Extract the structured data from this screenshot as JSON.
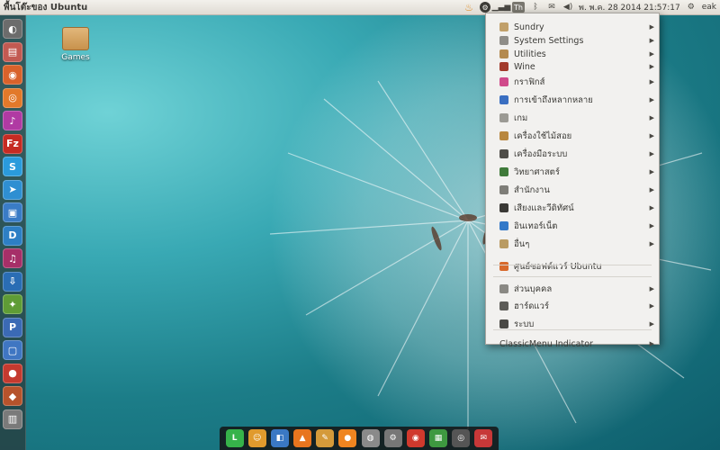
{
  "panel": {
    "window_title": "พื้นโต๊ะของ Ubuntu",
    "clock": "พ. พ.ค. 28 2014 21:57:17",
    "user": "eak",
    "keyboard_layout": "Th"
  },
  "desktop": {
    "icon_label": "Games"
  },
  "menu": {
    "items": [
      {
        "label": "Sundry",
        "icon": "sundry-icon",
        "color": "#c1a06a"
      },
      {
        "label": "System Settings",
        "icon": "settings-icon",
        "color": "#8f8d88"
      },
      {
        "label": "Utilities",
        "icon": "utilities-icon",
        "color": "#b48a4f"
      },
      {
        "label": "Wine",
        "icon": "wine-icon",
        "color": "#a23a2a"
      },
      {
        "label": "กราฟิกส์",
        "icon": "graphics-icon",
        "color": "#d04a8b"
      },
      {
        "label": "การเข้าถึงหลากหลาย",
        "icon": "accessibility-icon",
        "color": "#3a6fc1"
      },
      {
        "label": "เกม",
        "icon": "games-icon",
        "color": "#9b9a94"
      },
      {
        "label": "เครื่องใช้ไม้สอย",
        "icon": "accessories-icon",
        "color": "#b8873f"
      },
      {
        "label": "เครื่องมือระบบ",
        "icon": "system-tools-icon",
        "color": "#4f4d48"
      },
      {
        "label": "วิทยาศาสตร์",
        "icon": "science-icon",
        "color": "#3f7a3a"
      },
      {
        "label": "สำนักงาน",
        "icon": "office-icon",
        "color": "#7e7d78"
      },
      {
        "label": "เสียงและวีดิทัศน์",
        "icon": "multimedia-icon",
        "color": "#3a3936"
      },
      {
        "label": "อินเทอร์เน็ต",
        "icon": "internet-icon",
        "color": "#3479c8"
      },
      {
        "label": "อื่นๆ",
        "icon": "other-icon",
        "color": "#b99b63"
      },
      {
        "label": "ศูนย์ซอฟต์แวร์ Ubuntu",
        "icon": "software-center-icon",
        "color": "#d8692b"
      },
      {
        "label": "ส่วนบุคคล",
        "icon": "personal-icon",
        "color": "#8a8984"
      },
      {
        "label": "ฮาร์ดแวร์",
        "icon": "hardware-icon",
        "color": "#5d5c58"
      },
      {
        "label": "ระบบ",
        "icon": "system-icon",
        "color": "#4a4945"
      },
      {
        "label": "ClassicMenu Indicator",
        "icon": "",
        "color": ""
      }
    ]
  },
  "launcher": {
    "items": [
      {
        "name": "dash-home-icon",
        "glyph": "◐",
        "color": "#6c6c6c"
      },
      {
        "name": "files-icon",
        "glyph": "▤",
        "color": "#c25a52"
      },
      {
        "name": "chrome-icon",
        "glyph": "◉",
        "color": "#d9622b"
      },
      {
        "name": "firefox-icon",
        "glyph": "◎",
        "color": "#e2792a"
      },
      {
        "name": "note-icon",
        "glyph": "♪",
        "color": "#b03aa3"
      },
      {
        "name": "filezilla-icon",
        "glyph": "Fz",
        "color": "#c62b23"
      },
      {
        "name": "skype-icon",
        "glyph": "S",
        "color": "#2a9bdc"
      },
      {
        "name": "telegram-icon",
        "glyph": "➤",
        "color": "#2f8fd2"
      },
      {
        "name": "monitor-icon",
        "glyph": "▣",
        "color": "#3a7cc6"
      },
      {
        "name": "dropbox-icon",
        "glyph": "D",
        "color": "#2d7fc5"
      },
      {
        "name": "headphones-icon",
        "glyph": "♫",
        "color": "#a62f68"
      },
      {
        "name": "update-icon",
        "glyph": "⇩",
        "color": "#2a6db4"
      },
      {
        "name": "settings-wheel-icon",
        "glyph": "✦",
        "color": "#5f9c36"
      },
      {
        "name": "pidgin-icon",
        "glyph": "P",
        "color": "#3b6ab5"
      },
      {
        "name": "virtualbox-icon",
        "glyph": "▢",
        "color": "#3f76c2"
      },
      {
        "name": "record-icon",
        "glyph": "●",
        "color": "#c43a2f"
      },
      {
        "name": "image-viewer-icon",
        "glyph": "◆",
        "color": "#b6532c"
      },
      {
        "name": "trash-icon",
        "glyph": "▥",
        "color": "#7a7a7a"
      }
    ]
  },
  "dock": {
    "items": [
      {
        "name": "line-icon",
        "glyph": "L",
        "color": "#36b34a"
      },
      {
        "name": "user-icon",
        "glyph": "☺",
        "color": "#e09a2d"
      },
      {
        "name": "finder-icon",
        "glyph": "◧",
        "color": "#3a78c4"
      },
      {
        "name": "vlc-icon",
        "glyph": "▲",
        "color": "#e8751e"
      },
      {
        "name": "text-editor-icon",
        "glyph": "✎",
        "color": "#d49a3a"
      },
      {
        "name": "orange-ball-icon",
        "glyph": "●",
        "color": "#ef8520"
      },
      {
        "name": "disc-icon",
        "glyph": "◍",
        "color": "#8a8a8a"
      },
      {
        "name": "gear-icon",
        "glyph": "⚙",
        "color": "#777777"
      },
      {
        "name": "chrome-dock-icon",
        "glyph": "◉",
        "color": "#d0392d"
      },
      {
        "name": "photos-icon",
        "glyph": "▦",
        "color": "#3e9940"
      },
      {
        "name": "webcam-icon",
        "glyph": "◎",
        "color": "#555555"
      },
      {
        "name": "mail-icon",
        "glyph": "✉",
        "color": "#c73838"
      }
    ]
  }
}
